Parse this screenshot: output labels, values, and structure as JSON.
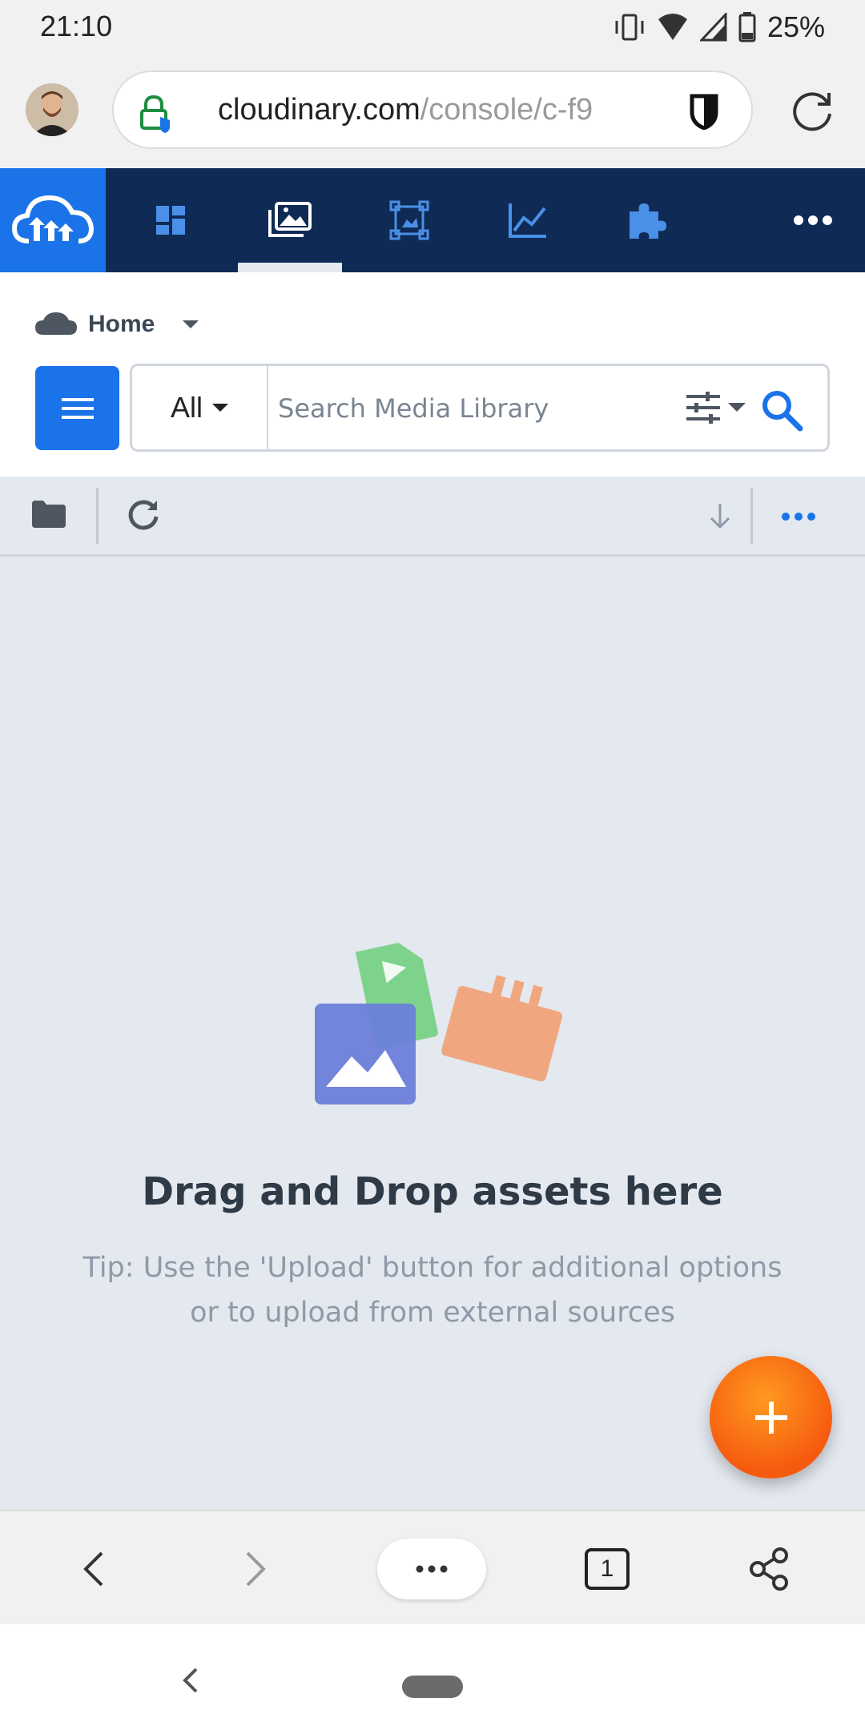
{
  "status_bar": {
    "time": "21:10",
    "battery": "25%"
  },
  "browser": {
    "url_domain": "cloudinary.com",
    "url_path": "/console/c-f9",
    "tab_count": "1"
  },
  "nav": {
    "items": [
      {
        "icon": "dashboard-icon"
      },
      {
        "icon": "media-library-icon",
        "active": true
      },
      {
        "icon": "transform-icon"
      },
      {
        "icon": "reports-icon"
      },
      {
        "icon": "addons-icon"
      },
      {
        "icon": "more-icon"
      }
    ]
  },
  "breadcrumb": {
    "label": "Home"
  },
  "search": {
    "scope": "All",
    "placeholder": "Search Media Library"
  },
  "empty_state": {
    "title": "Drag and Drop assets here",
    "tip_line1": "Tip: Use the 'Upload' button for additional options",
    "tip_line2": "or to upload from external sources"
  },
  "fab": {
    "label": "+"
  },
  "colors": {
    "nav_bg": "#0f2b55",
    "brand_blue": "#1a73e8",
    "fab_orange": "#f55a0f",
    "canvas": "#e4e8ef"
  }
}
